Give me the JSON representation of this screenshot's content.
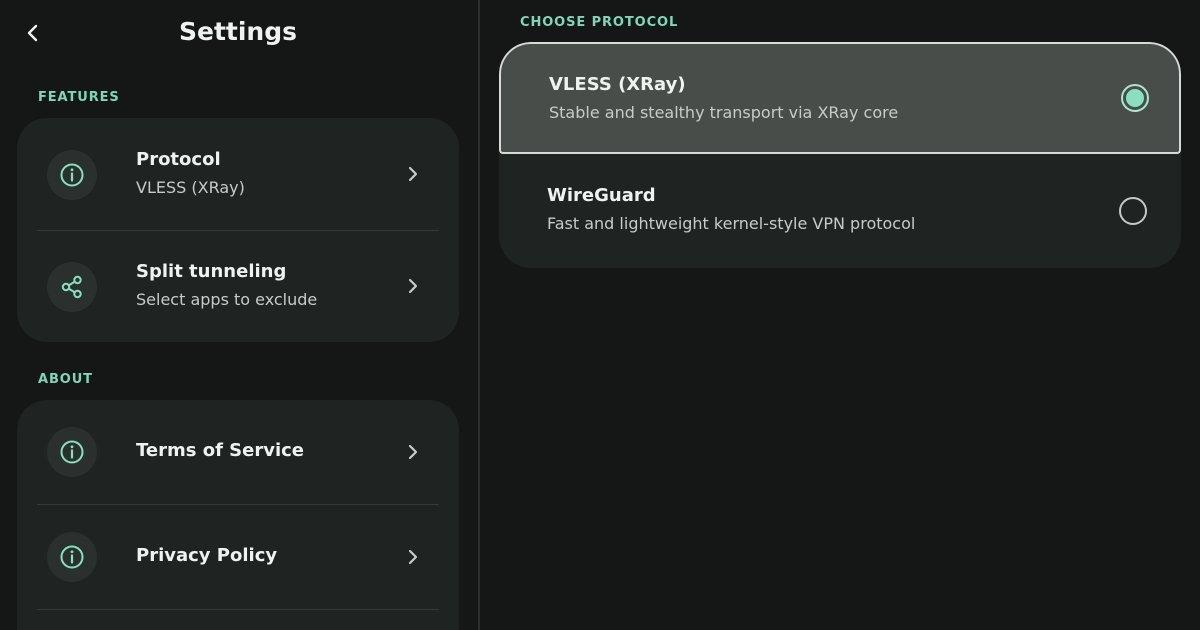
{
  "header": {
    "title": "Settings",
    "back_icon": "chevron-left-icon"
  },
  "features": {
    "label": "FEATURES",
    "items": [
      {
        "title": "Protocol",
        "subtitle": "VLESS (XRay)",
        "icon": "info-icon"
      },
      {
        "title": "Split tunneling",
        "subtitle": "Select apps to exclude",
        "icon": "share-icon"
      }
    ]
  },
  "about": {
    "label": "ABOUT",
    "items": [
      {
        "title": "Terms of Service",
        "icon": "info-icon"
      },
      {
        "title": "Privacy Policy",
        "icon": "info-icon"
      }
    ]
  },
  "protocol_picker": {
    "label": "CHOOSE PROTOCOL",
    "options": [
      {
        "title": "VLESS (XRay)",
        "subtitle": "Stable and stealthy transport via XRay core",
        "selected": true
      },
      {
        "title": "WireGuard",
        "subtitle": "Fast and lightweight kernel-style VPN protocol",
        "selected": false
      }
    ]
  },
  "colors": {
    "background": "#141716",
    "card": "#1f2321",
    "accent": "#7fd6b8",
    "selected_row": "#484d4a",
    "text_primary": "#eef2f0",
    "text_secondary": "#c6ccc9"
  }
}
